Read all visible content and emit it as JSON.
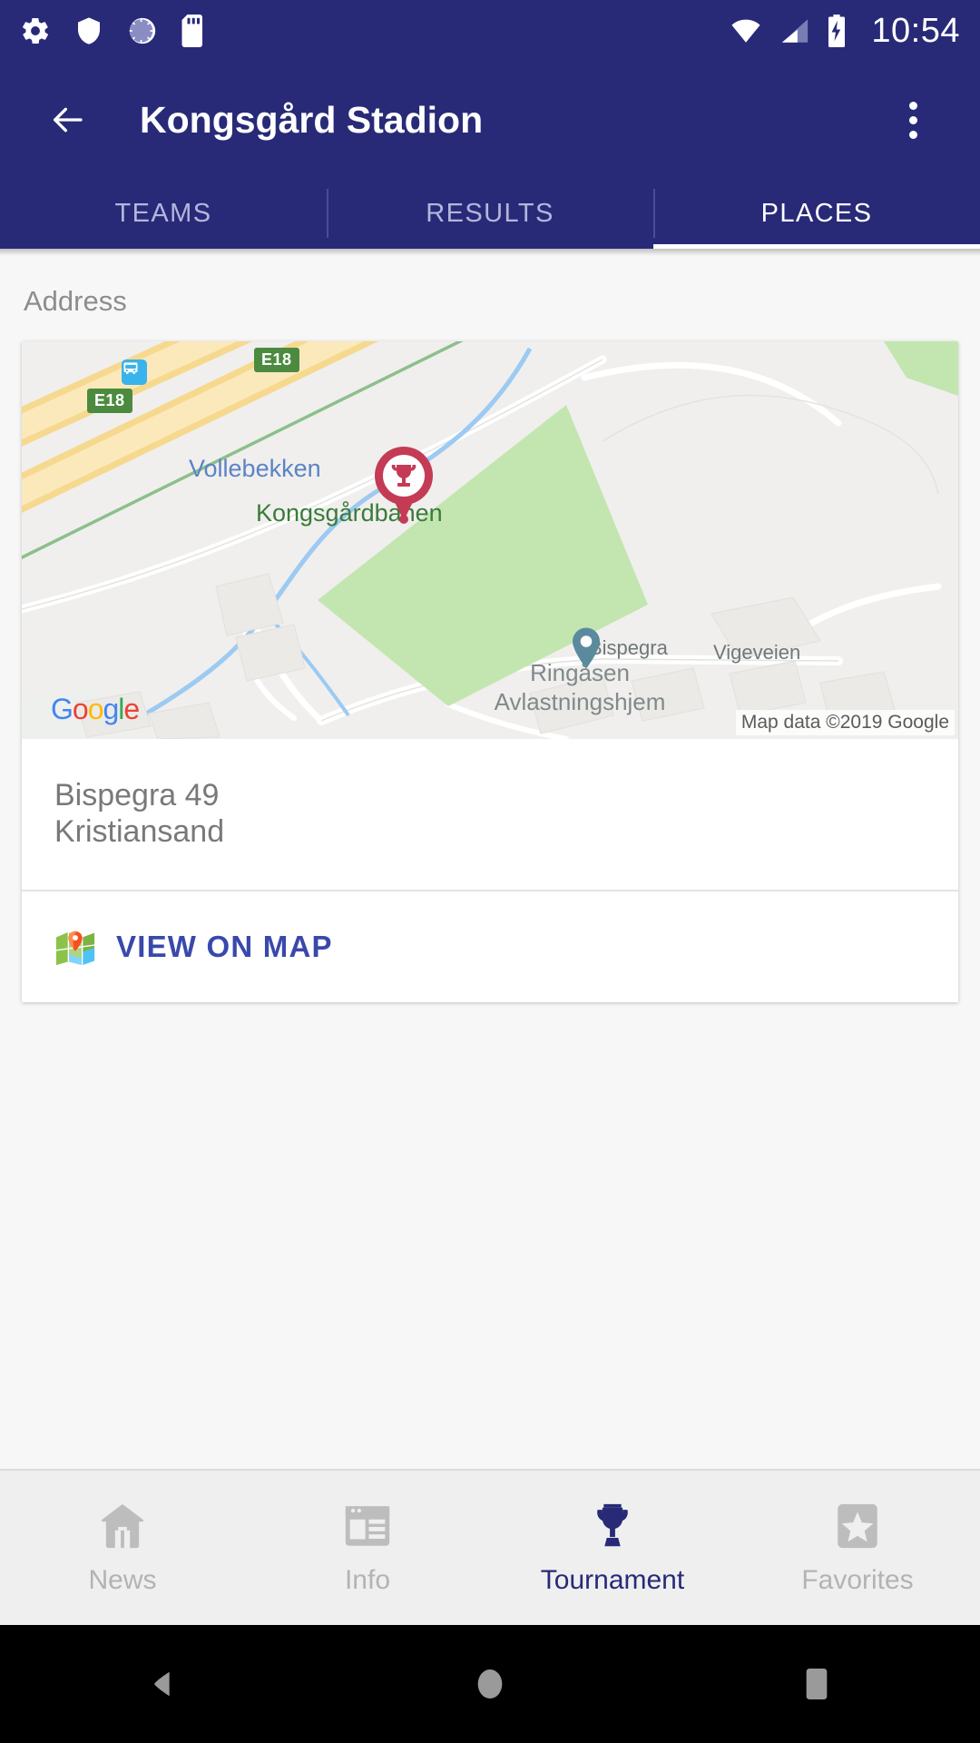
{
  "status_bar": {
    "icons_left": [
      "gear-icon",
      "shield-icon",
      "sync-circle-icon",
      "sd-card-icon"
    ],
    "icons_right": [
      "wifi-icon",
      "cell-signal-icon",
      "battery-charging-icon"
    ],
    "time": "10:54"
  },
  "app_bar": {
    "back_icon": "arrow-left-icon",
    "title": "Kongsgård Stadion",
    "overflow_icon": "more-vertical-icon"
  },
  "tabs": {
    "items": [
      {
        "label": "TEAMS",
        "active": false
      },
      {
        "label": "RESULTS",
        "active": false
      },
      {
        "label": "PLACES",
        "active": true
      }
    ]
  },
  "main": {
    "section_label": "Address",
    "map": {
      "labels": {
        "stream": "Vollebekken",
        "park": "Kongsgårdbanen",
        "poi_marker": "Bispegra",
        "building_line1": "Ringåsen",
        "building_line2": "Avlastningshjem"
      },
      "road_shields": [
        "E18",
        "E18"
      ],
      "transit_icon": "bus-stop-icon",
      "venue_marker_icon": "trophy-map-pin",
      "poi_marker_icon": "place-pin-icon",
      "logo": "Google",
      "attribution": "Map data ©2019 Google"
    },
    "address": {
      "line1": "Bispegra 49",
      "line2": "Kristiansand"
    },
    "view_on_map": {
      "icon": "map-emoji-icon",
      "label": "VIEW ON MAP"
    }
  },
  "bottom_nav": {
    "items": [
      {
        "label": "News",
        "icon": "home-icon",
        "active": false
      },
      {
        "label": "Info",
        "icon": "article-icon",
        "active": false
      },
      {
        "label": "Tournament",
        "icon": "trophy-icon",
        "active": true
      },
      {
        "label": "Favorites",
        "icon": "star-icon",
        "active": false
      }
    ]
  },
  "android_nav": {
    "back": "triangle-back-icon",
    "home": "circle-home-icon",
    "recents": "square-recents-icon"
  },
  "colors": {
    "primary": "#282a78",
    "accent_link": "#3949ab",
    "tab_inactive": "#b3b6db",
    "map_park": "#bfe6ab",
    "map_highway": "#f9dd9a",
    "map_water": "#9ccaf2",
    "marker_red": "#c43b56"
  }
}
